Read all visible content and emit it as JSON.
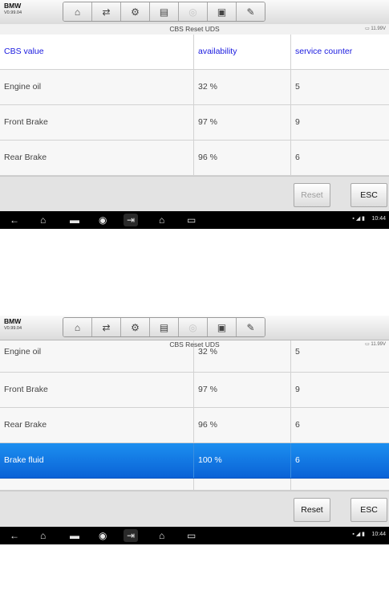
{
  "app": {
    "brand": "BMW",
    "version": "V0.99.04"
  },
  "toolbar": {
    "icons": [
      "home-icon",
      "vehicle-swap-icon",
      "settings-icon",
      "print-icon",
      "help-icon",
      "save-icon",
      "edit-icon"
    ]
  },
  "header": {
    "title": "CBS Reset UDS",
    "voltage": "11.99V"
  },
  "table": {
    "columns": [
      "CBS value",
      "availability",
      "service counter"
    ],
    "rows": [
      [
        "Engine oil",
        "32 %",
        "5"
      ],
      [
        "Front Brake",
        "97 %",
        "9"
      ],
      [
        "Rear Brake",
        "96 %",
        "6"
      ],
      [
        "Brake fluid",
        "100 %",
        "6"
      ]
    ],
    "selected_row": "Brake fluid"
  },
  "buttons": {
    "reset": "Reset",
    "esc": "ESC"
  },
  "screen1": {
    "reset_enabled": false
  },
  "screen2": {
    "reset_enabled": true
  },
  "navbar": {
    "icons": [
      "back-icon",
      "home-icon",
      "recent-apps-icon",
      "browser-icon",
      "exit-app-icon",
      "garage-icon",
      "car-icon"
    ],
    "time": "10:44"
  },
  "colors": {
    "selection": "#0a62d6",
    "header_text": "#1a1adf"
  }
}
